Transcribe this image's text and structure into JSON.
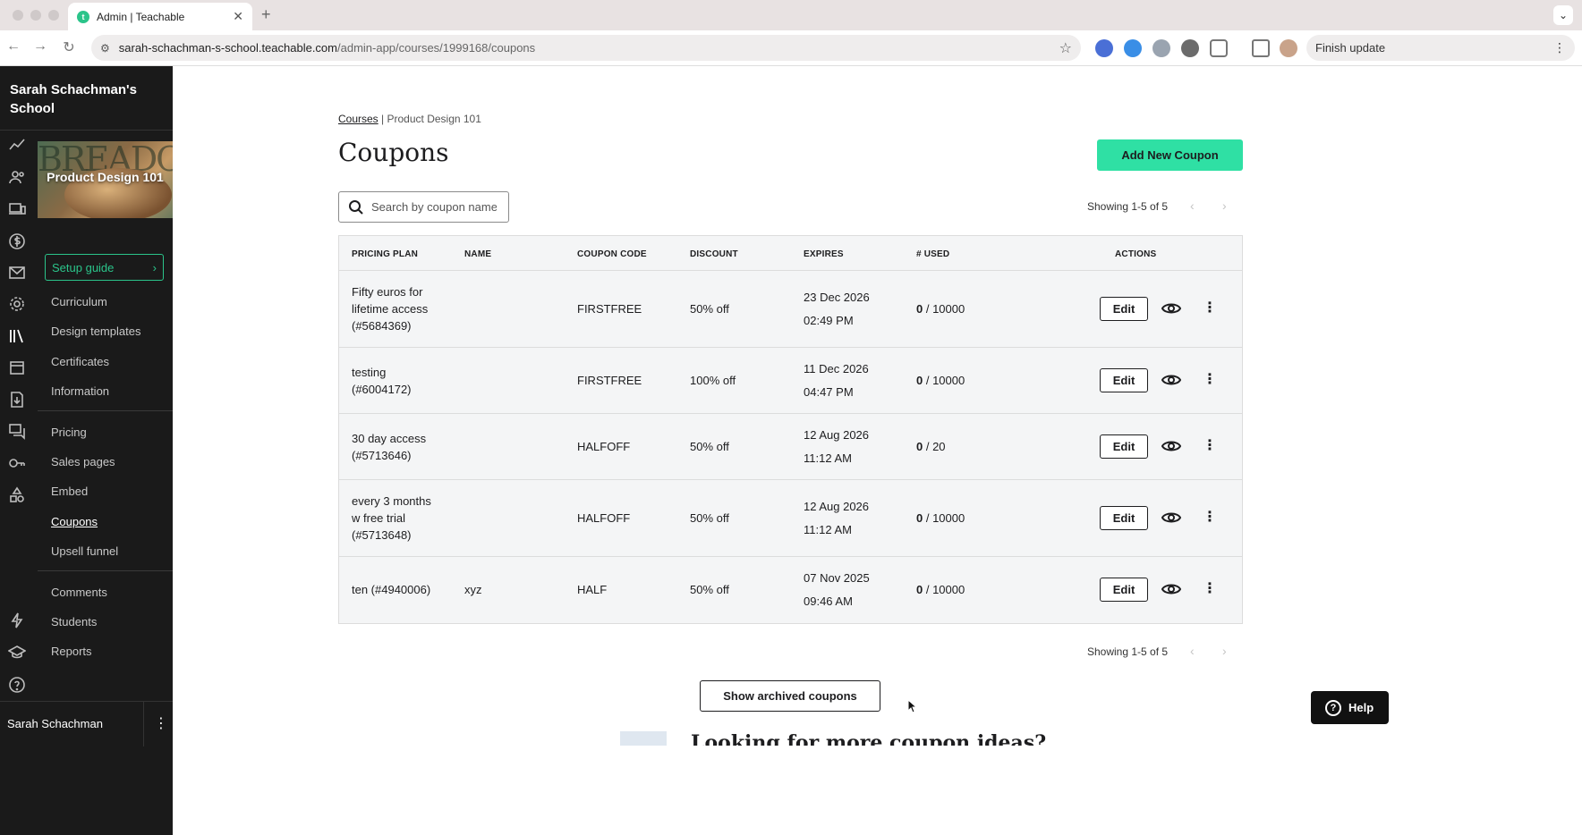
{
  "browser": {
    "tab_title": "Admin | Teachable",
    "favicon_letter": "t",
    "url_host": "sarah-schachman-s-school.teachable.com",
    "url_path": "/admin-app/courses/1999168/coupons",
    "finish_update_label": "Finish update"
  },
  "sidebar": {
    "school_name_line1": "Sarah Schachman's",
    "school_name_line2": "School",
    "course_title": "Product Design 101",
    "course_art_text": "BREADCIPES",
    "setup_guide_label": "Setup guide",
    "items_group1": [
      "Curriculum",
      "Design templates",
      "Certificates",
      "Information"
    ],
    "items_group2": [
      "Pricing",
      "Sales pages",
      "Embed",
      "Coupons",
      "Upsell funnel"
    ],
    "items_group3": [
      "Comments",
      "Students",
      "Reports"
    ],
    "active_item": "Coupons",
    "user_name": "Sarah Schachman"
  },
  "breadcrumb": {
    "root": "Courses",
    "separator": "|",
    "current": "Product Design 101"
  },
  "page": {
    "title": "Coupons",
    "add_button_label": "Add New Coupon",
    "search_placeholder": "Search by coupon name",
    "showing_text": "Showing 1-5 of 5",
    "archived_button_label": "Show archived coupons",
    "help_label": "Help",
    "peek_text": "Looking for more coupon ideas?"
  },
  "table": {
    "headers": {
      "plan": "PRICING PLAN",
      "name": "NAME",
      "code": "COUPON CODE",
      "discount": "DISCOUNT",
      "expires": "EXPIRES",
      "used": "# USED",
      "actions": "ACTIONS"
    },
    "edit_label": "Edit",
    "rows": [
      {
        "plan_l1": "Fifty euros for",
        "plan_l2": "lifetime access",
        "plan_l3": "(#5684369)",
        "name": "",
        "code": "FIRSTFREE",
        "discount": "50% off",
        "exp_date": "23 Dec 2026",
        "exp_time": "02:49 PM",
        "used": "0",
        "limit": " / 10000"
      },
      {
        "plan_l1": "testing",
        "plan_l2": "(#6004172)",
        "plan_l3": "",
        "name": "",
        "code": "FIRSTFREE",
        "discount": "100% off",
        "exp_date": "11 Dec 2026",
        "exp_time": "04:47 PM",
        "used": "0",
        "limit": " / 10000"
      },
      {
        "plan_l1": "30 day access",
        "plan_l2": "(#5713646)",
        "plan_l3": "",
        "name": "",
        "code": "HALFOFF",
        "discount": "50% off",
        "exp_date": "12 Aug 2026",
        "exp_time": "11:12 AM",
        "used": "0",
        "limit": " / 20"
      },
      {
        "plan_l1": "every 3 months",
        "plan_l2": "w free trial",
        "plan_l3": "(#5713648)",
        "name": "",
        "code": "HALFOFF",
        "discount": "50% off",
        "exp_date": "12 Aug 2026",
        "exp_time": "11:12 AM",
        "used": "0",
        "limit": " / 10000"
      },
      {
        "plan_l1": "ten (#4940006)",
        "plan_l2": "",
        "plan_l3": "",
        "name": "xyz",
        "code": "HALF",
        "discount": "50% off",
        "exp_date": "07 Nov 2025",
        "exp_time": "09:46 AM",
        "used": "0",
        "limit": " / 10000"
      }
    ]
  },
  "colors": {
    "accent": "#2fe0a4",
    "sidebar_bg": "#1a1a1a",
    "setup_green": "#2bc48a"
  }
}
